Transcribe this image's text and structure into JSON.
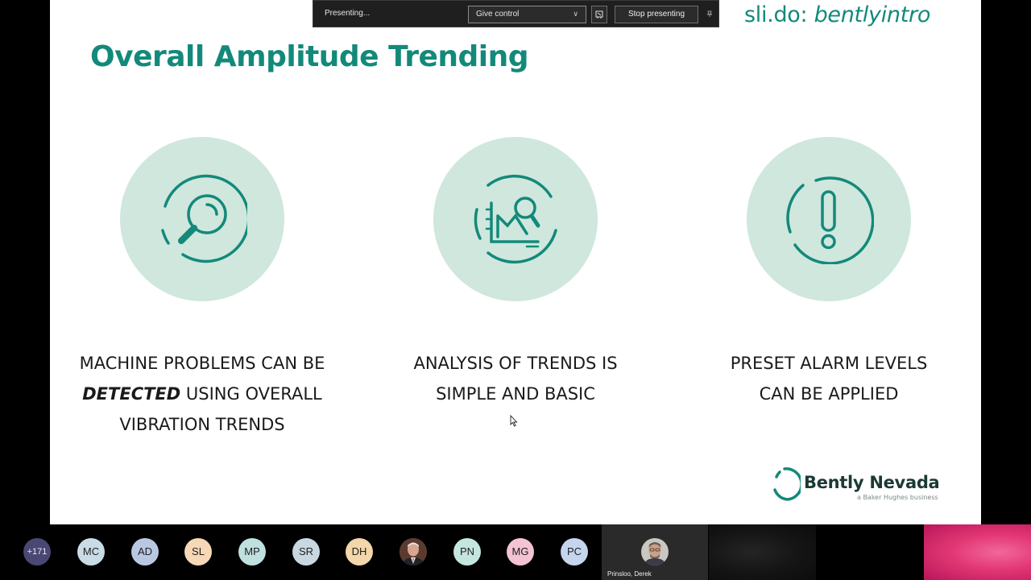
{
  "slide": {
    "title": "Overall Amplitude Trending",
    "slido_prefix": "sli.do: ",
    "slido_code": "bentlyintro",
    "columns": [
      {
        "icon": "magnifier-icon",
        "line1": "MACHINE PROBLEMS CAN BE",
        "emph": "DETECTED",
        "line2_rest": " USING OVERALL",
        "line3": "VIBRATION TRENDS"
      },
      {
        "icon": "chart-analysis-icon",
        "line1": "ANALYSIS OF TRENDS IS",
        "line2": "SIMPLE AND BASIC"
      },
      {
        "icon": "exclamation-icon",
        "line1": "PRESET ALARM LEVELS",
        "line2": "CAN BE APPLIED"
      }
    ],
    "logo": {
      "name": "Bently Nevada",
      "tagline": "a Baker Hughes business"
    },
    "accent_color": "#13897a",
    "circle_color": "#cfe7dd"
  },
  "presenting_bar": {
    "status": "Presenting...",
    "give_control_label": "Give control",
    "stop_label": "Stop presenting"
  },
  "participants": {
    "overflow_count": "+171",
    "avatars": [
      {
        "initials": "MC",
        "color": "#c9dbe5"
      },
      {
        "initials": "AD",
        "color": "#b9c8e2"
      },
      {
        "initials": "SL",
        "color": "#f6d8b6"
      },
      {
        "initials": "MP",
        "color": "#bfe0df"
      },
      {
        "initials": "SR",
        "color": "#c9d8e0"
      },
      {
        "initials": "DH",
        "color": "#f3d6a9"
      },
      {
        "initials": "PN",
        "color": "#c4e6df"
      },
      {
        "initials": "MG",
        "color": "#f3c3d3"
      },
      {
        "initials": "PC",
        "color": "#c5d5ee"
      }
    ],
    "active_speaker": "Prinsloo, Derek"
  }
}
